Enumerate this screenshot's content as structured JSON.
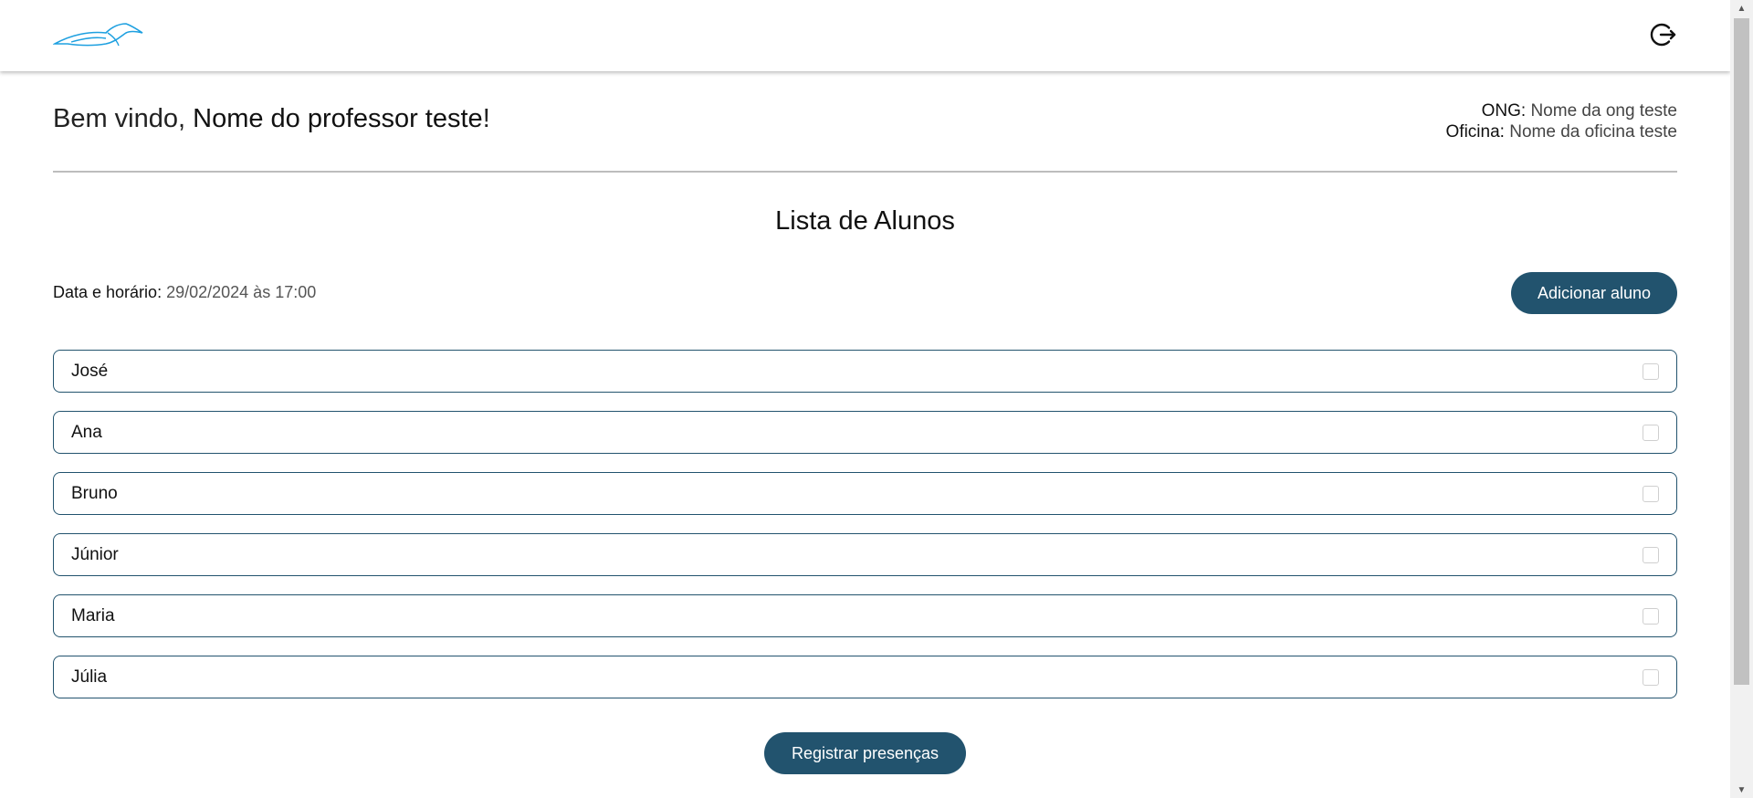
{
  "header": {
    "logo_icon": "bird-logo-icon",
    "logout_icon": "logout-icon"
  },
  "welcome": {
    "prefix": "Bem vindo, ",
    "name": "Nome do professor teste",
    "suffix": "!"
  },
  "org": {
    "ong_label": "ONG:",
    "ong_value": "Nome da ong teste",
    "oficina_label": "Oficina:",
    "oficina_value": "Nome da oficina teste"
  },
  "list": {
    "title": "Lista de Alunos",
    "datetime_label": "Data e horário:",
    "datetime_value": "29/02/2024 às 17:00",
    "add_button": "Adicionar aluno",
    "submit_button": "Registrar presenças",
    "students": [
      {
        "name": "José",
        "checked": false
      },
      {
        "name": "Ana",
        "checked": false
      },
      {
        "name": "Bruno",
        "checked": false
      },
      {
        "name": "Júnior",
        "checked": false
      },
      {
        "name": "Maria",
        "checked": false
      },
      {
        "name": "Júlia",
        "checked": false
      }
    ]
  },
  "colors": {
    "accent": "#22536e",
    "logo": "#1ea0e0"
  }
}
